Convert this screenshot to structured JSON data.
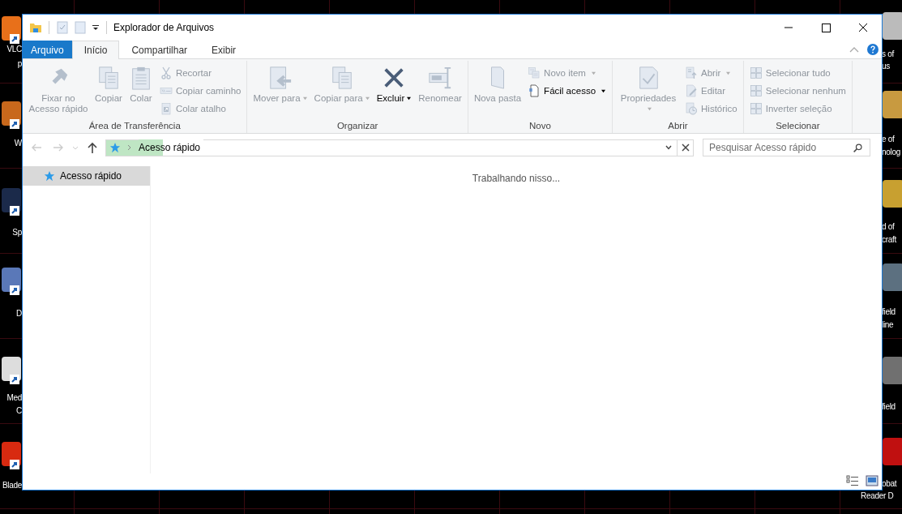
{
  "desktop": {
    "left_labels": [
      "VLC",
      "p",
      "W",
      "Sp",
      "D",
      "Med",
      "C",
      "Blade"
    ],
    "right_labels": [
      "s of",
      "us",
      "e of",
      "nolog",
      "d of",
      "craft",
      "field",
      "line",
      "field",
      "obat",
      "Reader D"
    ]
  },
  "window": {
    "title": "Explorador de Arquivos"
  },
  "tabs": [
    {
      "label": "Arquivo",
      "kind": "file",
      "selected": false
    },
    {
      "label": "Início",
      "kind": "tab",
      "selected": true
    },
    {
      "label": "Compartilhar",
      "kind": "tab",
      "selected": false
    },
    {
      "label": "Exibir",
      "kind": "tab",
      "selected": false
    }
  ],
  "ribbon": {
    "groups": [
      {
        "label": "Área de Transferência",
        "items": [
          {
            "kind": "large",
            "label": "Fixar no Acesso rápido",
            "disabled": true,
            "dropdown": false
          },
          {
            "kind": "large",
            "label": "Copiar",
            "disabled": true,
            "dropdown": false
          },
          {
            "kind": "large",
            "label": "Colar",
            "disabled": true,
            "dropdown": false
          },
          {
            "kind": "small",
            "label": "Recortar",
            "disabled": true,
            "dropdown": false
          },
          {
            "kind": "small",
            "label": "Copiar caminho",
            "disabled": true,
            "dropdown": false
          },
          {
            "kind": "small",
            "label": "Colar atalho",
            "disabled": true,
            "dropdown": false
          }
        ]
      },
      {
        "label": "Organizar",
        "items": [
          {
            "kind": "large",
            "label": "Mover para",
            "disabled": true,
            "dropdown": true
          },
          {
            "kind": "large",
            "label": "Copiar para",
            "disabled": true,
            "dropdown": true
          },
          {
            "kind": "large",
            "label": "Excluir",
            "disabled": false,
            "dropdown": true
          },
          {
            "kind": "large",
            "label": "Renomear",
            "disabled": true,
            "dropdown": false
          }
        ]
      },
      {
        "label": "Novo",
        "items": [
          {
            "kind": "large",
            "label": "Nova pasta",
            "disabled": true,
            "dropdown": false
          },
          {
            "kind": "small",
            "label": "Novo item",
            "disabled": true,
            "dropdown": true
          },
          {
            "kind": "small",
            "label": "Fácil acesso",
            "disabled": false,
            "dropdown": true
          }
        ]
      },
      {
        "label": "Abrir",
        "items": [
          {
            "kind": "large",
            "label": "Propriedades",
            "disabled": true,
            "dropdown": true
          },
          {
            "kind": "small",
            "label": "Abrir",
            "disabled": true,
            "dropdown": true
          },
          {
            "kind": "small",
            "label": "Editar",
            "disabled": true,
            "dropdown": false
          },
          {
            "kind": "small",
            "label": "Histórico",
            "disabled": true,
            "dropdown": false
          }
        ]
      },
      {
        "label": "Selecionar",
        "items": [
          {
            "kind": "small",
            "label": "Selecionar tudo",
            "disabled": true,
            "dropdown": false
          },
          {
            "kind": "small",
            "label": "Selecionar nenhum",
            "disabled": true,
            "dropdown": false
          },
          {
            "kind": "small",
            "label": "Inverter seleção",
            "disabled": true,
            "dropdown": false
          }
        ]
      }
    ]
  },
  "address_bar": {
    "back_disabled": true,
    "forward_disabled": true,
    "up_disabled": false,
    "path": "Acesso rápido",
    "search_placeholder": "Pesquisar Acesso rápido"
  },
  "navigation": {
    "items": [
      {
        "label": "Acesso rápido",
        "selected": true
      }
    ]
  },
  "content": {
    "message": "Trabalhando nisso..."
  }
}
